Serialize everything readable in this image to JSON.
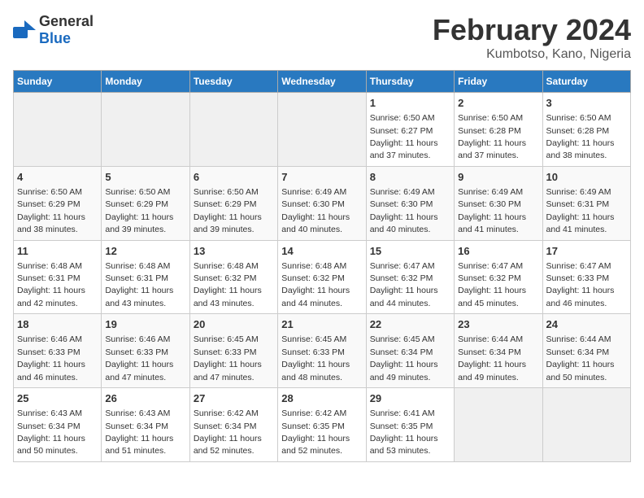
{
  "logo": {
    "general": "General",
    "blue": "Blue"
  },
  "title": "February 2024",
  "subtitle": "Kumbotso, Kano, Nigeria",
  "days": [
    "Sunday",
    "Monday",
    "Tuesday",
    "Wednesday",
    "Thursday",
    "Friday",
    "Saturday"
  ],
  "weeks": [
    [
      {
        "day": "",
        "info": ""
      },
      {
        "day": "",
        "info": ""
      },
      {
        "day": "",
        "info": ""
      },
      {
        "day": "",
        "info": ""
      },
      {
        "day": "1",
        "info": "Sunrise: 6:50 AM\nSunset: 6:27 PM\nDaylight: 11 hours\nand 37 minutes."
      },
      {
        "day": "2",
        "info": "Sunrise: 6:50 AM\nSunset: 6:28 PM\nDaylight: 11 hours\nand 37 minutes."
      },
      {
        "day": "3",
        "info": "Sunrise: 6:50 AM\nSunset: 6:28 PM\nDaylight: 11 hours\nand 38 minutes."
      }
    ],
    [
      {
        "day": "4",
        "info": "Sunrise: 6:50 AM\nSunset: 6:29 PM\nDaylight: 11 hours\nand 38 minutes."
      },
      {
        "day": "5",
        "info": "Sunrise: 6:50 AM\nSunset: 6:29 PM\nDaylight: 11 hours\nand 39 minutes."
      },
      {
        "day": "6",
        "info": "Sunrise: 6:50 AM\nSunset: 6:29 PM\nDaylight: 11 hours\nand 39 minutes."
      },
      {
        "day": "7",
        "info": "Sunrise: 6:49 AM\nSunset: 6:30 PM\nDaylight: 11 hours\nand 40 minutes."
      },
      {
        "day": "8",
        "info": "Sunrise: 6:49 AM\nSunset: 6:30 PM\nDaylight: 11 hours\nand 40 minutes."
      },
      {
        "day": "9",
        "info": "Sunrise: 6:49 AM\nSunset: 6:30 PM\nDaylight: 11 hours\nand 41 minutes."
      },
      {
        "day": "10",
        "info": "Sunrise: 6:49 AM\nSunset: 6:31 PM\nDaylight: 11 hours\nand 41 minutes."
      }
    ],
    [
      {
        "day": "11",
        "info": "Sunrise: 6:48 AM\nSunset: 6:31 PM\nDaylight: 11 hours\nand 42 minutes."
      },
      {
        "day": "12",
        "info": "Sunrise: 6:48 AM\nSunset: 6:31 PM\nDaylight: 11 hours\nand 43 minutes."
      },
      {
        "day": "13",
        "info": "Sunrise: 6:48 AM\nSunset: 6:32 PM\nDaylight: 11 hours\nand 43 minutes."
      },
      {
        "day": "14",
        "info": "Sunrise: 6:48 AM\nSunset: 6:32 PM\nDaylight: 11 hours\nand 44 minutes."
      },
      {
        "day": "15",
        "info": "Sunrise: 6:47 AM\nSunset: 6:32 PM\nDaylight: 11 hours\nand 44 minutes."
      },
      {
        "day": "16",
        "info": "Sunrise: 6:47 AM\nSunset: 6:32 PM\nDaylight: 11 hours\nand 45 minutes."
      },
      {
        "day": "17",
        "info": "Sunrise: 6:47 AM\nSunset: 6:33 PM\nDaylight: 11 hours\nand 46 minutes."
      }
    ],
    [
      {
        "day": "18",
        "info": "Sunrise: 6:46 AM\nSunset: 6:33 PM\nDaylight: 11 hours\nand 46 minutes."
      },
      {
        "day": "19",
        "info": "Sunrise: 6:46 AM\nSunset: 6:33 PM\nDaylight: 11 hours\nand 47 minutes."
      },
      {
        "day": "20",
        "info": "Sunrise: 6:45 AM\nSunset: 6:33 PM\nDaylight: 11 hours\nand 47 minutes."
      },
      {
        "day": "21",
        "info": "Sunrise: 6:45 AM\nSunset: 6:33 PM\nDaylight: 11 hours\nand 48 minutes."
      },
      {
        "day": "22",
        "info": "Sunrise: 6:45 AM\nSunset: 6:34 PM\nDaylight: 11 hours\nand 49 minutes."
      },
      {
        "day": "23",
        "info": "Sunrise: 6:44 AM\nSunset: 6:34 PM\nDaylight: 11 hours\nand 49 minutes."
      },
      {
        "day": "24",
        "info": "Sunrise: 6:44 AM\nSunset: 6:34 PM\nDaylight: 11 hours\nand 50 minutes."
      }
    ],
    [
      {
        "day": "25",
        "info": "Sunrise: 6:43 AM\nSunset: 6:34 PM\nDaylight: 11 hours\nand 50 minutes."
      },
      {
        "day": "26",
        "info": "Sunrise: 6:43 AM\nSunset: 6:34 PM\nDaylight: 11 hours\nand 51 minutes."
      },
      {
        "day": "27",
        "info": "Sunrise: 6:42 AM\nSunset: 6:34 PM\nDaylight: 11 hours\nand 52 minutes."
      },
      {
        "day": "28",
        "info": "Sunrise: 6:42 AM\nSunset: 6:35 PM\nDaylight: 11 hours\nand 52 minutes."
      },
      {
        "day": "29",
        "info": "Sunrise: 6:41 AM\nSunset: 6:35 PM\nDaylight: 11 hours\nand 53 minutes."
      },
      {
        "day": "",
        "info": ""
      },
      {
        "day": "",
        "info": ""
      }
    ]
  ]
}
